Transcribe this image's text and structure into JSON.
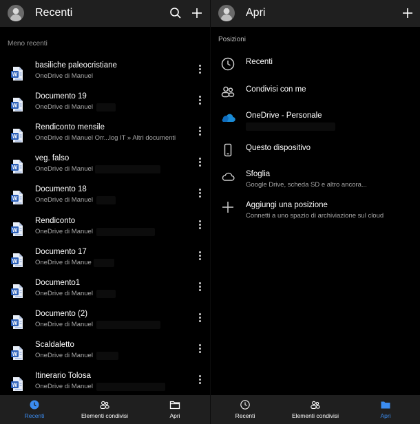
{
  "left": {
    "title": "Recenti",
    "section_label": "Meno recenti",
    "files": [
      {
        "name": "basiliche paleocristiane",
        "sub": "OneDrive di Manuel"
      },
      {
        "name": "Documento 19",
        "sub": "OneDrive di Manuel"
      },
      {
        "name": "Rendiconto mensile",
        "sub": "OneDrive di Manuel Orr...log IT » Altri documenti"
      },
      {
        "name": "veg. falso",
        "sub": "OneDrive di Manuel"
      },
      {
        "name": "Documento 18",
        "sub": "OneDrive di Manuel"
      },
      {
        "name": "Rendiconto",
        "sub": "OneDrive di Manuel"
      },
      {
        "name": "Documento 17",
        "sub": "OneDrive di Manue"
      },
      {
        "name": "Documento1",
        "sub": "OneDrive di Manuel"
      },
      {
        "name": "Documento (2)",
        "sub": "OneDrive di Manuel"
      },
      {
        "name": "Scaldaletto",
        "sub": "OneDrive di Manuel"
      },
      {
        "name": "Itinerario Tolosa",
        "sub": "OneDrive di Manuel"
      }
    ],
    "tabs": [
      {
        "label": "Recenti",
        "icon": "clock-icon",
        "active": true
      },
      {
        "label": "Elementi condivisi",
        "icon": "people-icon",
        "active": false
      },
      {
        "label": "Apri",
        "icon": "folder-icon",
        "active": false
      }
    ]
  },
  "right": {
    "title": "Apri",
    "section_label": "Posizioni",
    "places": [
      {
        "title": "Recenti",
        "sub": "",
        "icon": "clock-icon"
      },
      {
        "title": "Condivisi con me",
        "sub": "",
        "icon": "people-icon"
      },
      {
        "title": "OneDrive - Personale",
        "sub": "",
        "icon": "onedrive-cloud-icon"
      },
      {
        "title": "Questo dispositivo",
        "sub": "",
        "icon": "phone-icon"
      },
      {
        "title": "Sfoglia",
        "sub": "Google Drive, scheda SD e altro ancora...",
        "icon": "cloud-outline-icon"
      },
      {
        "title": "Aggiungi una posizione",
        "sub": "Connetti a uno spazio di archiviazione sul cloud",
        "icon": "plus-icon"
      }
    ],
    "tabs": [
      {
        "label": "Recenti",
        "icon": "clock-icon",
        "active": false
      },
      {
        "label": "Elementi condivisi",
        "icon": "people-icon",
        "active": false
      },
      {
        "label": "Apri",
        "icon": "folder-icon",
        "active": true
      }
    ]
  },
  "colors": {
    "accent": "#3b8cf0",
    "bar_bg": "#1f1f1f",
    "word_blue": "#2b5fb8",
    "onedrive_blue": "#1a8bd6"
  }
}
